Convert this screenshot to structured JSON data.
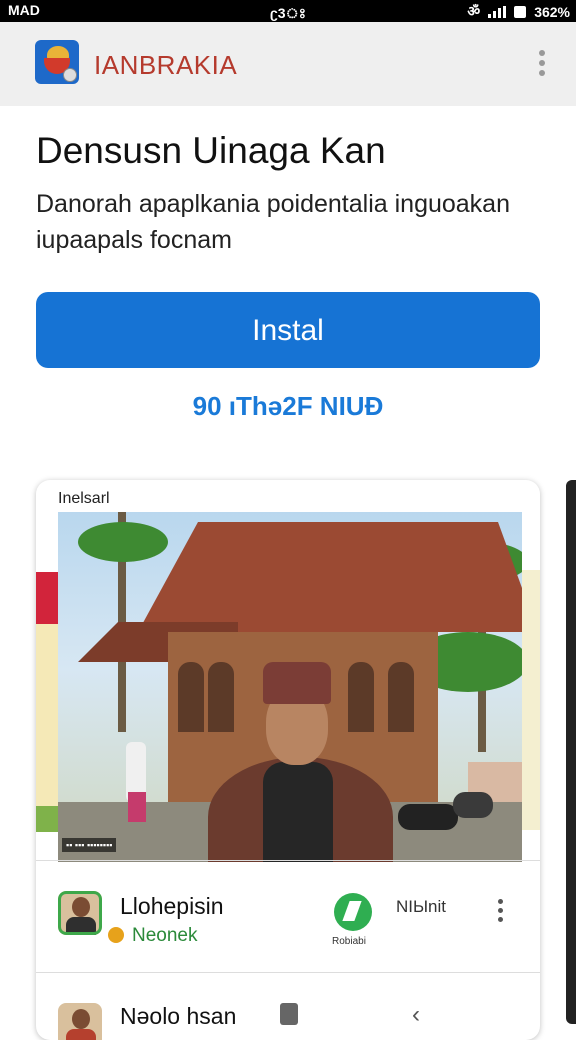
{
  "status_bar": {
    "left": "MAD",
    "center": "ʗ3ঃ",
    "battery": "362%"
  },
  "app_bar": {
    "app_name": "IANBRAKIA",
    "logo_icon": "app-logo-icon",
    "menu_icon": "more-vert-icon"
  },
  "header": {
    "title": "Densusn Uinaga Kan",
    "description": "Danorah apaplkania poidentalia inguoakan iupaapals focnam"
  },
  "install": {
    "label": "Instal",
    "meta": "90 ıThə2F NIUƉ"
  },
  "card": {
    "label": "Inelsarl",
    "image_caption": "▪▪ ▪▪▪ ▪▪▪▪▪▪▪▪"
  },
  "rows": [
    {
      "title": "Llohepisin",
      "subtitle": "Neonek",
      "action_label": "Robiabi",
      "meta": "NIЫnit"
    },
    {
      "title": "Nəolo hsan"
    }
  ],
  "colors": {
    "accent": "#1673d4",
    "brand_text": "#b53a2d",
    "success": "#2fae51"
  }
}
